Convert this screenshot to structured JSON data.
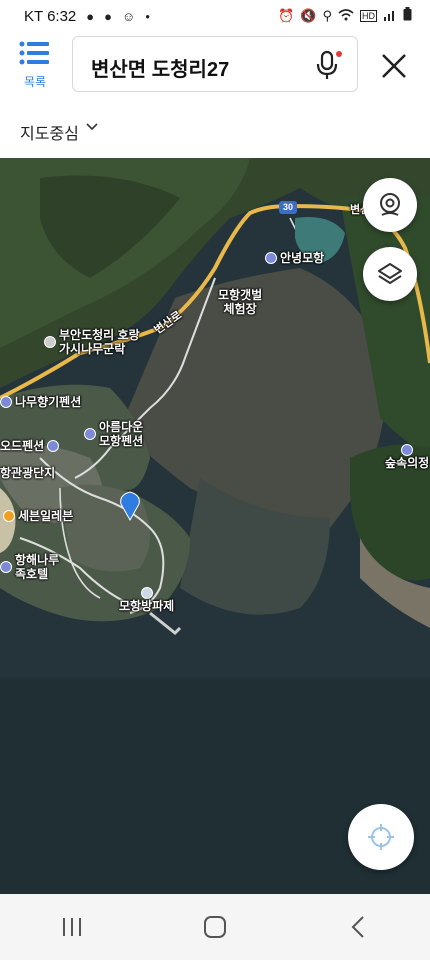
{
  "status_bar": {
    "carrier_time": "KT 6:32",
    "left_icons": [
      "notification-icon",
      "notification-icon",
      "face-icon",
      "dot-icon"
    ],
    "right_icons": [
      "alarm-icon",
      "mute-icon",
      "location-icon",
      "wifi-icon",
      "lte-icon",
      "signal-icon",
      "battery-icon"
    ],
    "lte_label": "HD"
  },
  "header": {
    "menu_label": "목록",
    "search_value": "변산면 도청리27",
    "mic_icon": "microphone-icon",
    "close_icon": "close-icon"
  },
  "map_center": {
    "label": "지도중심"
  },
  "map": {
    "type": "satellite",
    "road_number": "30",
    "road_labels": [
      "변산로",
      "변산"
    ],
    "pois": [
      {
        "id": "annyeong",
        "name": "안녕모항"
      },
      {
        "id": "mohang-gaetbeol",
        "name": "모항갯벌\n체험장"
      },
      {
        "id": "buan",
        "name": "부안도청리 호랑\n가시나무군락"
      },
      {
        "id": "namu",
        "name": "나무향기펜션"
      },
      {
        "id": "ode",
        "name": "오드펜션"
      },
      {
        "id": "areumdaun",
        "name": "아름다운\n모항펜션"
      },
      {
        "id": "hanggwan",
        "name": "항관광단지"
      },
      {
        "id": "sebeunilrebeun",
        "name": "세븐일레븐"
      },
      {
        "id": "haenaru",
        "name": "항해나루\n족호텔"
      },
      {
        "id": "bangpaje",
        "name": "모항방파제"
      },
      {
        "id": "sumsoguijeong",
        "name": "숲속의정"
      }
    ],
    "accent_color": "#2f7de1",
    "road_color": "#e8b84a"
  },
  "controls": {
    "street_view_icon": "street-view-icon",
    "layers_icon": "layers-icon",
    "locate_icon": "locate-icon"
  },
  "nav_bar": {
    "icons": [
      "recent-apps-icon",
      "home-icon",
      "back-icon"
    ]
  }
}
